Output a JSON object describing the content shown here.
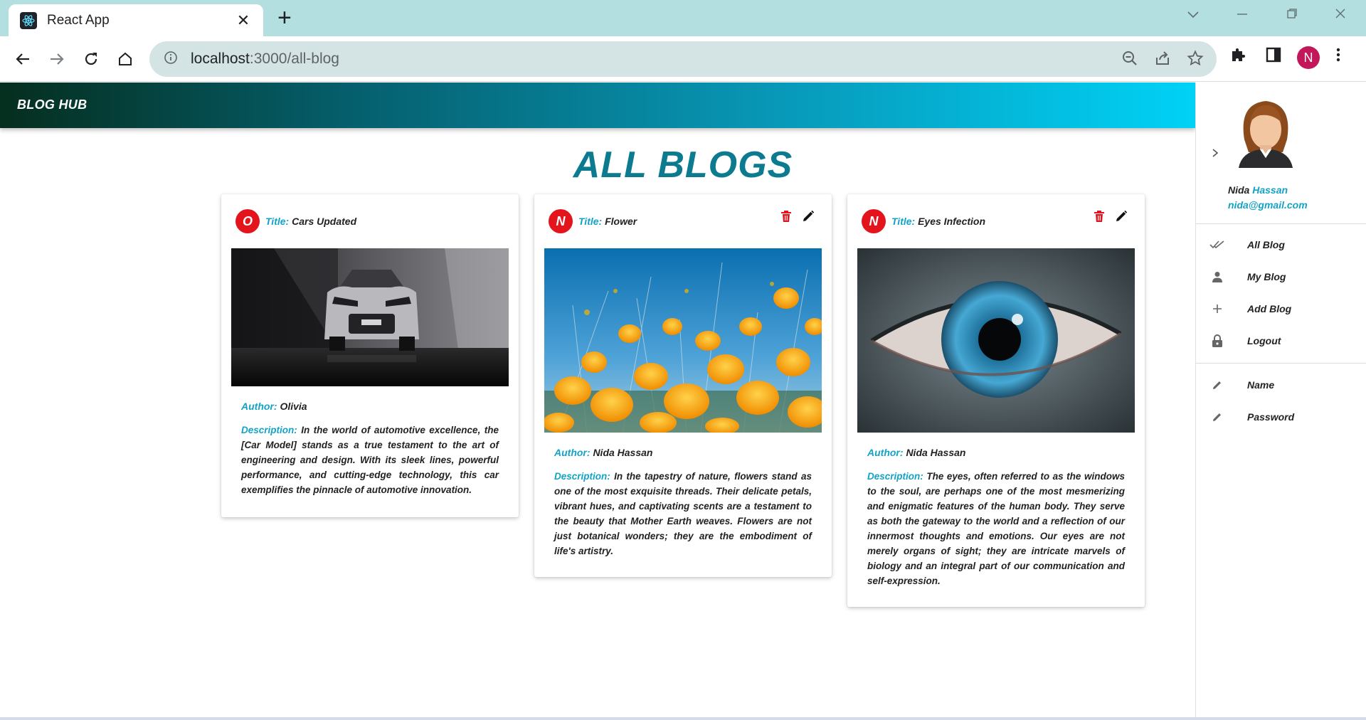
{
  "browser": {
    "tab_title": "React App",
    "url_host": "localhost",
    "url_path": ":3000/all-blog",
    "profile_initial": "N"
  },
  "app": {
    "brand": "BLOG HUB",
    "page_title": "ALL BLOGS",
    "title_label": "Title:",
    "author_label": "Author:",
    "description_label": "Description:"
  },
  "cards": [
    {
      "initial": "O",
      "title": "Cars Updated",
      "author": "Olivia",
      "description": "In the world of automotive excellence, the [Car Model] stands as a true testament to the art of engineering and design. With its sleek lines, powerful performance, and cutting-edge technology, this car exemplifies the pinnacle of automotive innovation."
    },
    {
      "initial": "N",
      "title": "Flower",
      "author": "Nida Hassan",
      "description": "In the tapestry of nature, flowers stand as one of the most exquisite threads. Their delicate petals, vibrant hues, and captivating scents are a testament to the beauty that Mother Earth weaves. Flowers are not just botanical wonders; they are the embodiment of life's artistry."
    },
    {
      "initial": "N",
      "title": "Eyes Infection",
      "author": "Nida Hassan",
      "description": "The eyes, often referred to as the windows to the soul, are perhaps one of the most mesmerizing and enigmatic features of the human body. They serve as both the gateway to the world and a reflection of our innermost thoughts and emotions. Our eyes are not merely organs of sight; they are intricate marvels of biology and an integral part of our communication and self-expression."
    }
  ],
  "sidebar": {
    "user_first": "Nida",
    "user_last": "Hassan",
    "email": "nida@gmail.com",
    "menu": [
      {
        "label": "All Blog",
        "icon": "double-check-icon"
      },
      {
        "label": "My Blog",
        "icon": "person-icon"
      },
      {
        "label": "Add Blog",
        "icon": "plus-icon"
      },
      {
        "label": "Logout",
        "icon": "lock-icon"
      }
    ],
    "settings": [
      {
        "label": "Name",
        "icon": "pencil-icon"
      },
      {
        "label": "Password",
        "icon": "pencil-icon"
      }
    ]
  },
  "colors": {
    "accent": "#13a3c4",
    "title": "#0c7a8f",
    "avatar": "#e4141d",
    "delete": "#e4141d"
  }
}
